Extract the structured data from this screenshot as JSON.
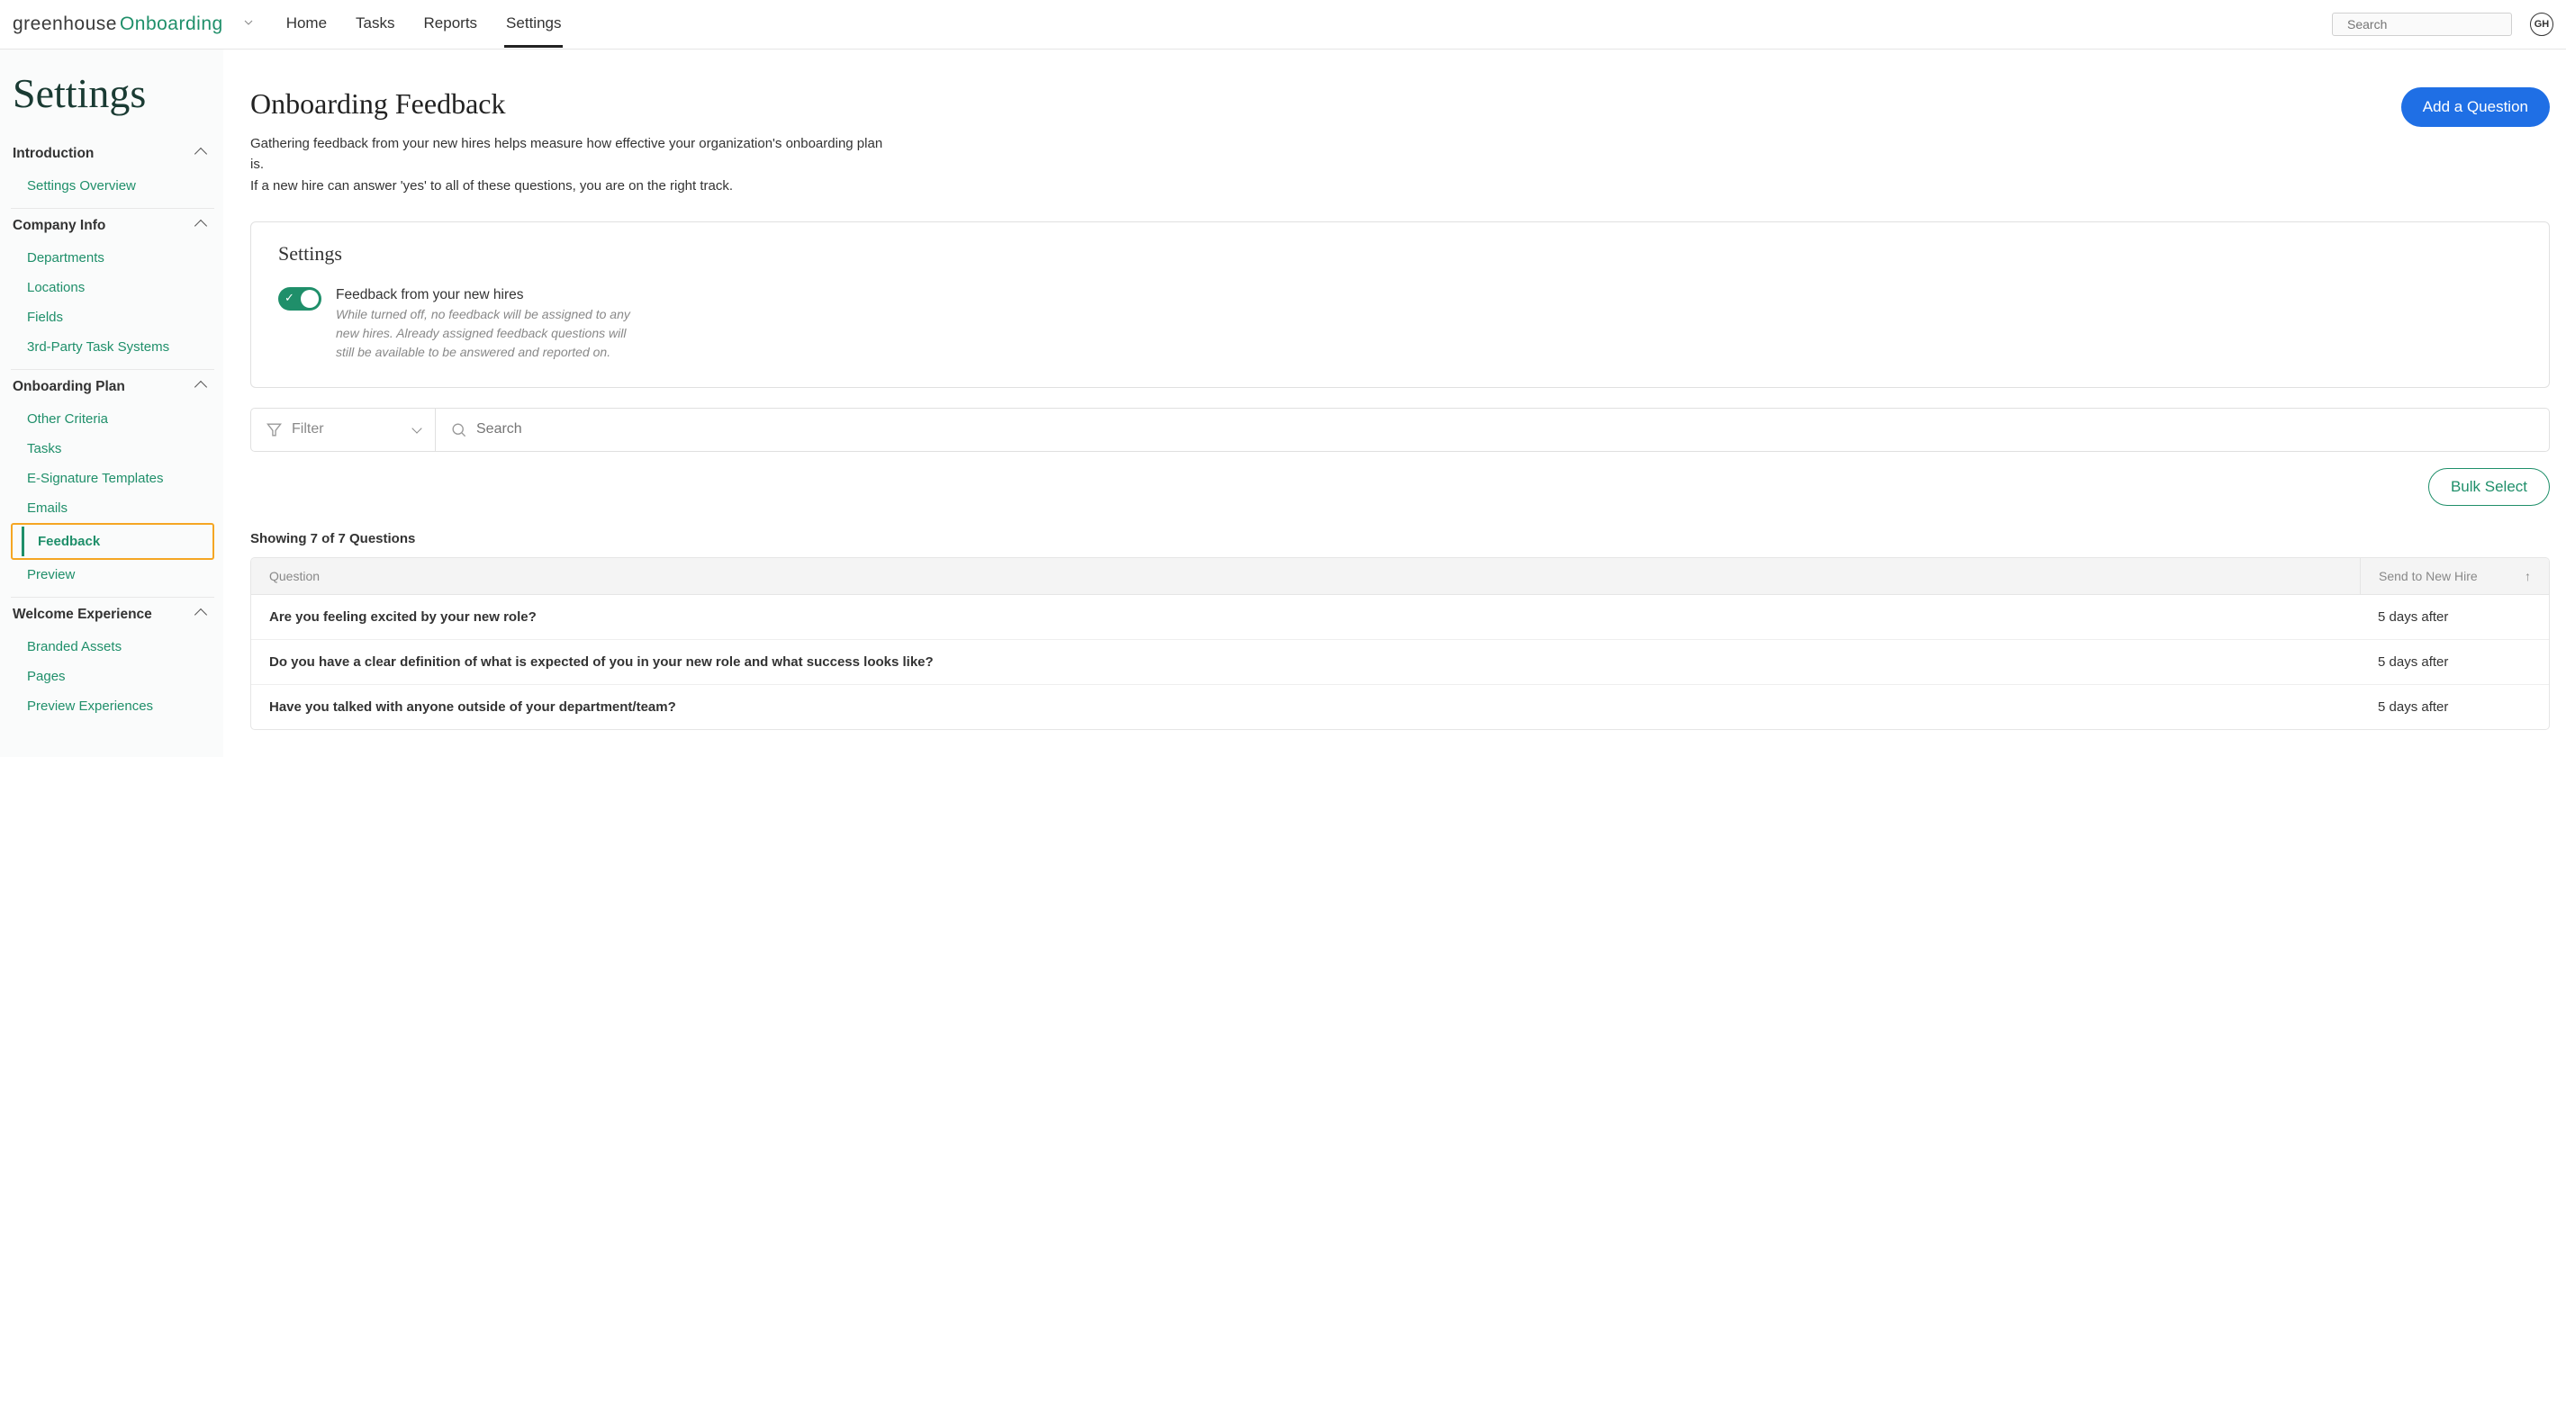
{
  "header": {
    "brand_1": "greenhouse",
    "brand_2": "Onboarding",
    "nav": [
      "Home",
      "Tasks",
      "Reports",
      "Settings"
    ],
    "active_nav": "Settings",
    "search_placeholder": "Search",
    "avatar_initials": "GH"
  },
  "page_title": "Settings",
  "sidebar": {
    "sections": [
      {
        "title": "Introduction",
        "items": [
          "Settings Overview"
        ]
      },
      {
        "title": "Company Info",
        "items": [
          "Departments",
          "Locations",
          "Fields",
          "3rd-Party Task Systems"
        ]
      },
      {
        "title": "Onboarding Plan",
        "items": [
          "Other Criteria",
          "Tasks",
          "E-Signature Templates",
          "Emails",
          "Feedback",
          "Preview"
        ],
        "active": "Feedback"
      },
      {
        "title": "Welcome Experience",
        "items": [
          "Branded Assets",
          "Pages",
          "Preview Experiences"
        ]
      }
    ]
  },
  "content": {
    "title": "Onboarding Feedback",
    "subtitle_1": "Gathering feedback from your new hires helps measure how effective your organization's onboarding plan is.",
    "subtitle_2": "If a new hire can answer 'yes' to all of these questions, you are on the right track.",
    "add_button": "Add a Question",
    "settings_card": {
      "heading": "Settings",
      "toggle_on": true,
      "toggle_title": "Feedback from your new hires",
      "toggle_sub": "While turned off, no feedback will be assigned to any new hires. Already assigned feedback questions will still be available to be answered and reported on."
    },
    "filter_label": "Filter",
    "search_placeholder": "Search",
    "bulk_select": "Bulk Select",
    "showing": "Showing 7 of 7 Questions",
    "table": {
      "col_question": "Question",
      "col_send": "Send to New Hire",
      "rows": [
        {
          "q": "Are you feeling excited by your new role?",
          "send": "5 days after"
        },
        {
          "q": "Do you have a clear definition of what is expected of you in your new role and what success looks like?",
          "send": "5 days after"
        },
        {
          "q": "Have you talked with anyone outside of your department/team?",
          "send": "5 days after"
        }
      ]
    }
  }
}
